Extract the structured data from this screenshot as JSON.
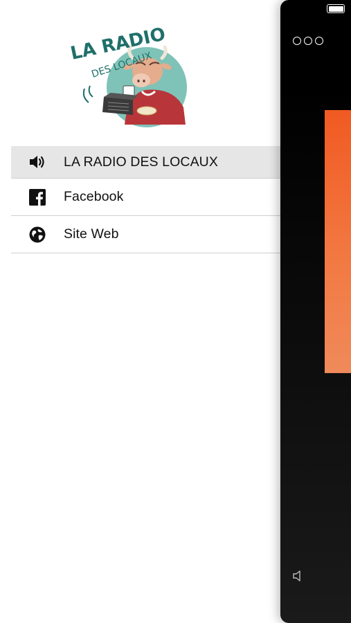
{
  "menu": {
    "items": [
      {
        "label": "LA RADIO DES LOCAUX",
        "icon": "speaker-icon",
        "active": true
      },
      {
        "label": "Facebook",
        "icon": "facebook-icon",
        "active": false
      },
      {
        "label": "Site Web",
        "icon": "globe-icon",
        "active": false
      }
    ]
  },
  "logo": {
    "text_line1": "LA RADIO",
    "text_line2": "DES LOCAUX"
  },
  "colors": {
    "banner": "#f15a22",
    "active_row": "#e6e6e6",
    "panel_bg": "#000000"
  }
}
